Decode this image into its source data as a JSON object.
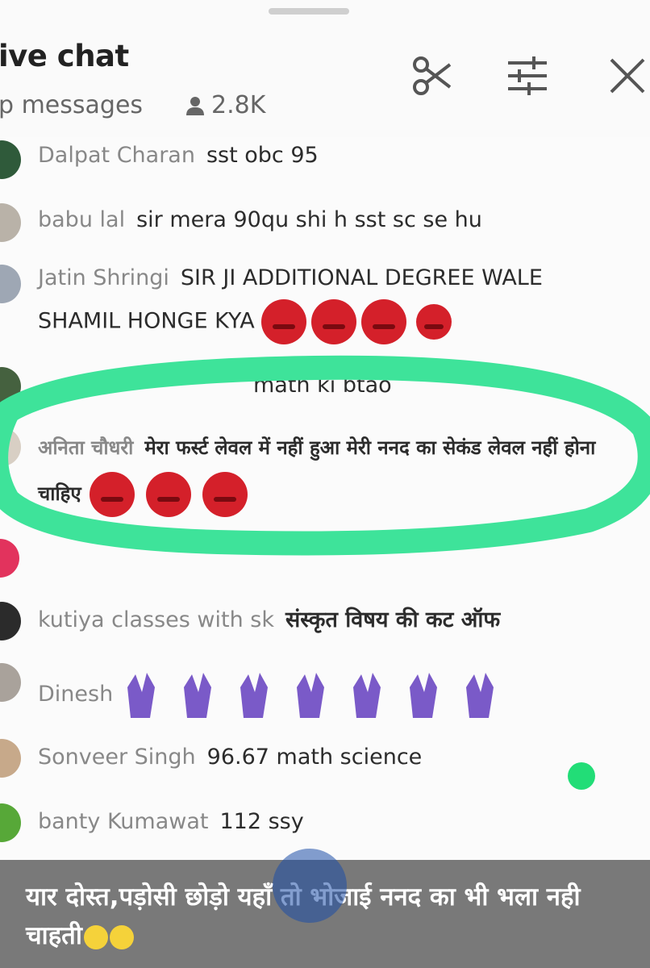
{
  "header": {
    "title": "ive chat",
    "subtitle": "p messages",
    "viewer_count": "2.8K",
    "icons": [
      "scissors-icon",
      "tune-icon",
      "close-icon"
    ]
  },
  "messages": [
    {
      "author": "Dalpat Charan",
      "text": "sst obc 95"
    },
    {
      "author": "babu lal",
      "text": "sir mera 90qu shi h sst sc se hu"
    },
    {
      "author": "Jatin Shringi",
      "text": "SIR JI ADDITIONAL DEGREE WALE SHAMIL HONGE KYA"
    },
    {
      "author": "",
      "text": "math ki btao"
    },
    {
      "author": "अनिता चौधरी",
      "text": "मेरा फर्स्ट लेवल में नहीं हुआ मेरी ननद का सेकंड लेवल नहीं होना चाहिए"
    },
    {
      "author": "kutiya classes with sk",
      "text": "संस्कृत विषय की कट ऑफ"
    },
    {
      "author": "Dinesh",
      "text": ""
    },
    {
      "author": "Sonveer Singh",
      "text": "96.67 math science"
    },
    {
      "author": "banty Kumawat",
      "text": "112 ssy"
    }
  ],
  "caption": {
    "text": "यार दोस्त,पड़ोसी छोड़ो यहाँ तो भोजाई ननद का भी भला नही चाहती"
  },
  "colors": {
    "highlight": "#3ee39a",
    "online": "#22dd77",
    "caption_bg": "#6e6e6e"
  }
}
